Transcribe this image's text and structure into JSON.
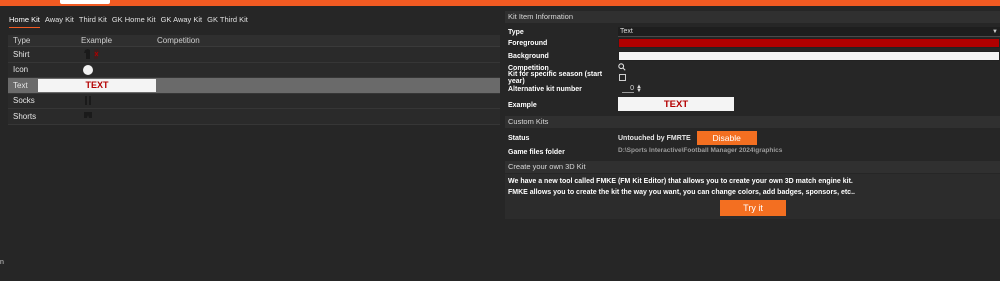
{
  "tabs": [
    "Home Kit",
    "Away Kit",
    "Third Kit",
    "GK Home Kit",
    "GK Away Kit",
    "GK Third Kit"
  ],
  "table": {
    "headers": {
      "type": "Type",
      "example": "Example",
      "competition": "Competition"
    },
    "rows": [
      {
        "type": "Shirt"
      },
      {
        "type": "Icon"
      },
      {
        "type": "Text",
        "example_text": "TEXT"
      },
      {
        "type": "Socks"
      },
      {
        "type": "Shorts"
      }
    ]
  },
  "kit_item": {
    "section_title": "Kit Item Information",
    "type_label": "Type",
    "type_value": "Text",
    "foreground_label": "Foreground",
    "foreground_color": "#b00000",
    "background_label": "Background",
    "background_color": "#f4f4f4",
    "competition_label": "Competition",
    "season_label": "Kit for specific season (start year)",
    "alt_number_label": "Alternative kit number",
    "alt_number_value": "0",
    "example_label": "Example",
    "example_text": "TEXT"
  },
  "custom_kits": {
    "section_title": "Custom Kits",
    "status_label": "Status",
    "status_value": "Untouched by FMRTE",
    "disable_button": "Disable",
    "game_files_label": "Game files folder",
    "game_files_value": "D:\\Sports Interactive\\Football Manager 2024\\graphics"
  },
  "fmke": {
    "section_title": "Create your own 3D Kit",
    "line1": "We have a new tool called FMKE (FM Kit Editor) that allows you to create your own 3D match engine kit.",
    "line2": "FMKE allows you to create the kit the way you want, you can change colors, add badges, sponsors, etc..",
    "try_button": "Try it"
  },
  "bottom_left_text": "n",
  "colors": {
    "accent": "#f15a22",
    "button": "#f36f21",
    "text_red": "#b30000"
  }
}
